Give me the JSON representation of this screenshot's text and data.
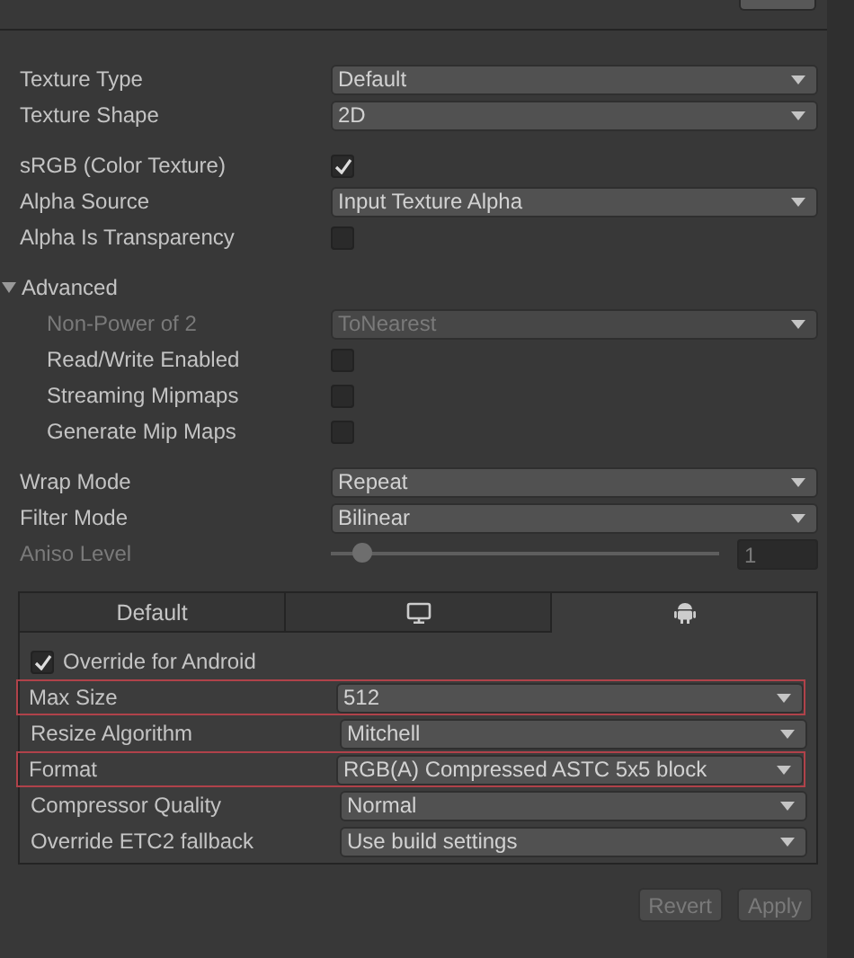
{
  "sections": [
    [
      {
        "kind": "dropdown",
        "label": "Texture Type",
        "value": "Default",
        "disabled": false
      },
      {
        "kind": "dropdown",
        "label": "Texture Shape",
        "value": "2D",
        "disabled": false
      }
    ],
    [
      {
        "kind": "checkbox",
        "label": "sRGB (Color Texture)",
        "checked": true,
        "disabled": false
      },
      {
        "kind": "dropdown",
        "label": "Alpha Source",
        "value": "Input Texture Alpha",
        "disabled": false
      },
      {
        "kind": "checkbox",
        "label": "Alpha Is Transparency",
        "checked": false,
        "disabled": false
      }
    ],
    [
      {
        "kind": "foldout",
        "label": "Advanced",
        "expanded": true,
        "disabled": false,
        "children": [
          {
            "kind": "dropdown",
            "label": "Non-Power of 2",
            "value": "ToNearest",
            "disabled": true
          },
          {
            "kind": "checkbox",
            "label": "Read/Write Enabled",
            "checked": false,
            "disabled": false
          },
          {
            "kind": "checkbox",
            "label": "Streaming Mipmaps",
            "checked": false,
            "disabled": false
          },
          {
            "kind": "checkbox",
            "label": "Generate Mip Maps",
            "checked": false,
            "disabled": false
          }
        ]
      }
    ],
    [
      {
        "kind": "dropdown",
        "label": "Wrap Mode",
        "value": "Repeat",
        "disabled": false
      },
      {
        "kind": "dropdown",
        "label": "Filter Mode",
        "value": "Bilinear",
        "disabled": false
      },
      {
        "kind": "slider",
        "label": "Aniso Level",
        "level": 0.08,
        "value": "1",
        "disabled": true
      }
    ]
  ],
  "platform_tabs": [
    {
      "kind": "text",
      "label": "Default",
      "selected": false
    },
    {
      "kind": "monitor",
      "selected": false
    },
    {
      "kind": "android",
      "selected": true
    }
  ],
  "platform_settings": [
    {
      "kind": "checkbox",
      "label": "Override for Android",
      "checked": true,
      "highlighted": false
    },
    {
      "kind": "dropdown",
      "label": "Max Size",
      "value": "512",
      "highlighted": true
    },
    {
      "kind": "dropdown",
      "label": "Resize Algorithm",
      "value": "Mitchell",
      "highlighted": false
    },
    {
      "kind": "dropdown",
      "label": "Format",
      "value": "RGB(A) Compressed ASTC 5x5 block",
      "highlighted": true
    },
    {
      "kind": "dropdown",
      "label": "Compressor Quality",
      "value": "Normal",
      "highlighted": false
    },
    {
      "kind": "dropdown",
      "label": "Override ETC2 fallback",
      "value": "Use build settings",
      "highlighted": false
    }
  ],
  "buttons": [
    {
      "label": "Revert",
      "disabled": true
    },
    {
      "label": "Apply",
      "disabled": true
    }
  ]
}
